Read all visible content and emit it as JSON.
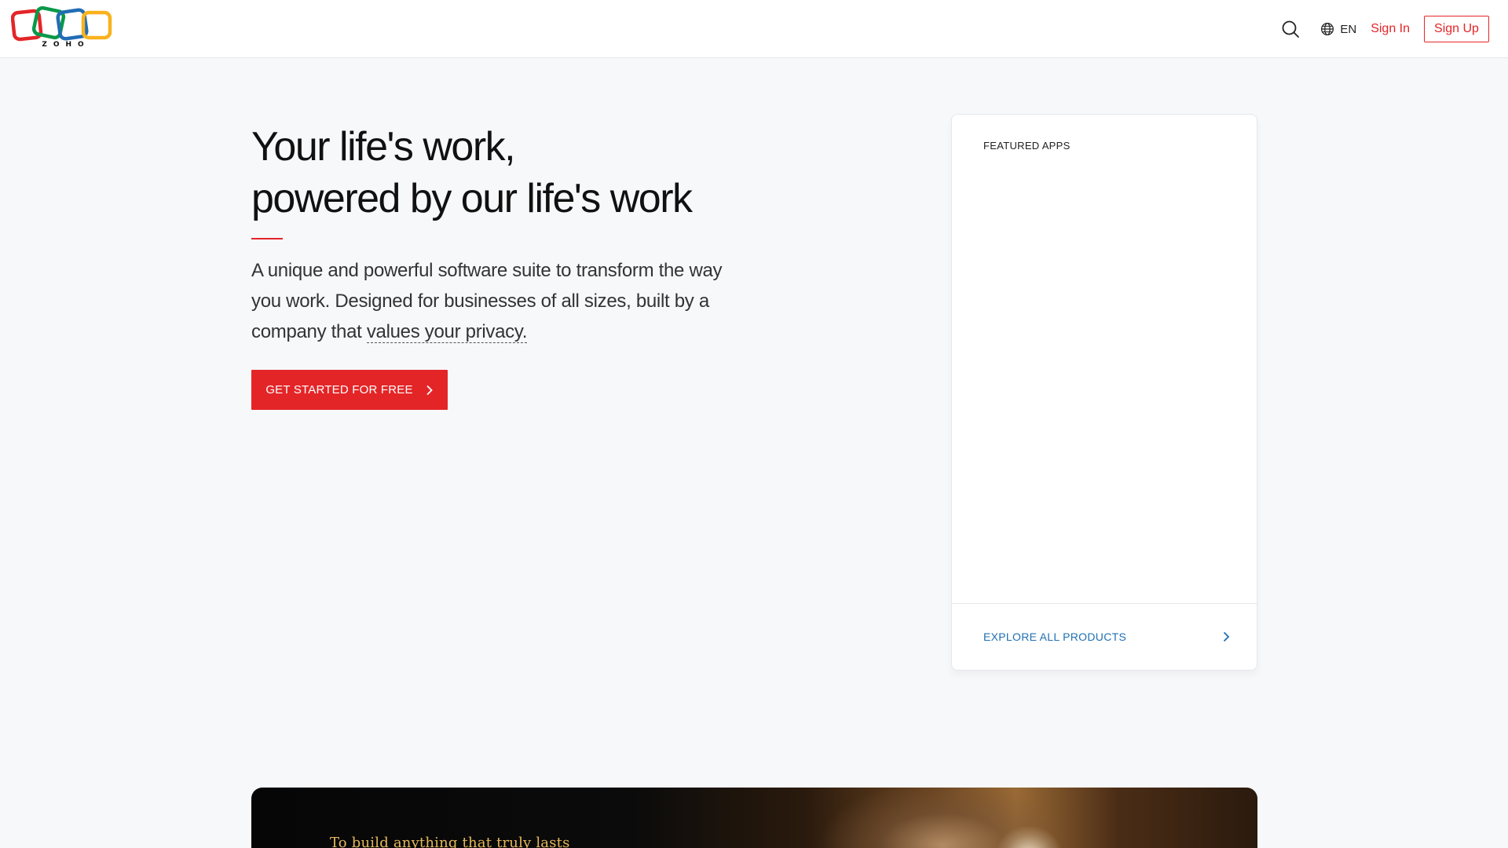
{
  "header": {
    "brand": "ZOHO",
    "language": "EN",
    "sign_in": "Sign In",
    "sign_up": "Sign Up",
    "icons": [
      "search-icon",
      "globe-icon"
    ]
  },
  "hero": {
    "title_line1": "Your life's work,",
    "title_line2": "powered by our life's work",
    "description_start": "A unique and powerful software suite to transform the way you work. Designed for businesses of all sizes, built by a company that ",
    "description_link": "values your privacy.",
    "cta_label": "GET STARTED FOR FREE"
  },
  "featured_card": {
    "title": "FEATURED APPS",
    "footer_label": "EXPLORE ALL PRODUCTS"
  },
  "banner": {
    "quote": "To build anything that truly lasts"
  },
  "colors": {
    "brand_red": "#e42527",
    "link_blue": "#1f6fb2",
    "page_bg": "#f7f8fa",
    "quote_gold": "#e6b85a",
    "logo_red": "#e42527",
    "logo_green": "#089949",
    "logo_blue": "#226db4",
    "logo_yellow": "#f9b21d"
  }
}
